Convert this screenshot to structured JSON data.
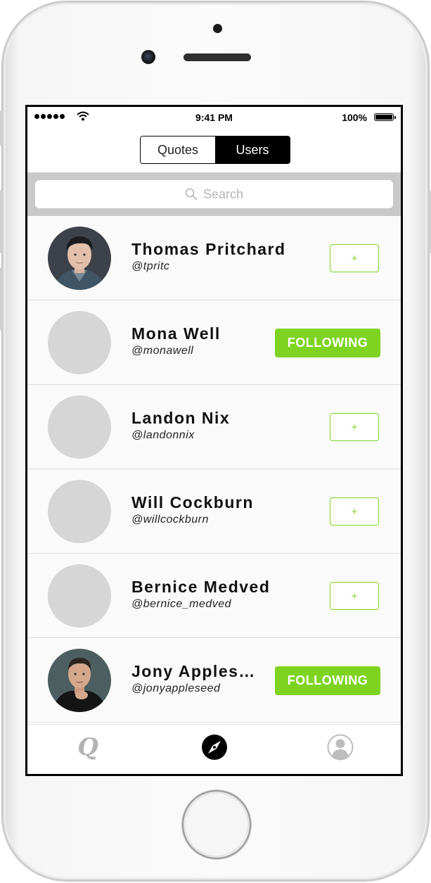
{
  "status_bar": {
    "time": "9:41 PM",
    "battery": "100%"
  },
  "segmented_control": {
    "options": [
      "Quotes",
      "Users"
    ],
    "selected": "Users"
  },
  "search": {
    "placeholder": "Search"
  },
  "users": [
    {
      "name": "Thomas Pritchard",
      "handle": "@tpritc",
      "action": "+",
      "following": false,
      "avatar": "photo"
    },
    {
      "name": "Mona Well",
      "handle": "@monawell",
      "action": "FOLLOWING",
      "following": true,
      "avatar": "placeholder"
    },
    {
      "name": "Landon Nix",
      "handle": "@landonnix",
      "action": "+",
      "following": false,
      "avatar": "placeholder"
    },
    {
      "name": "Will Cockburn",
      "handle": "@willcockburn",
      "action": "+",
      "following": false,
      "avatar": "placeholder"
    },
    {
      "name": "Bernice Medved",
      "handle": "@bernice_medved",
      "action": "+",
      "following": false,
      "avatar": "placeholder"
    },
    {
      "name": "Jony Apples…",
      "handle": "@jonyappleseed",
      "action": "FOLLOWING",
      "following": true,
      "avatar": "photo"
    }
  ],
  "tab_bar": {
    "quotes_glyph": "Q",
    "items": [
      "quotes-tab-icon",
      "compass-icon",
      "profile-icon"
    ],
    "active": "compass-icon"
  },
  "colors": {
    "accent_green": "#7ed321",
    "search_bar_bg": "#c9c9c9",
    "avatar_placeholder": "#d6d6d6"
  }
}
